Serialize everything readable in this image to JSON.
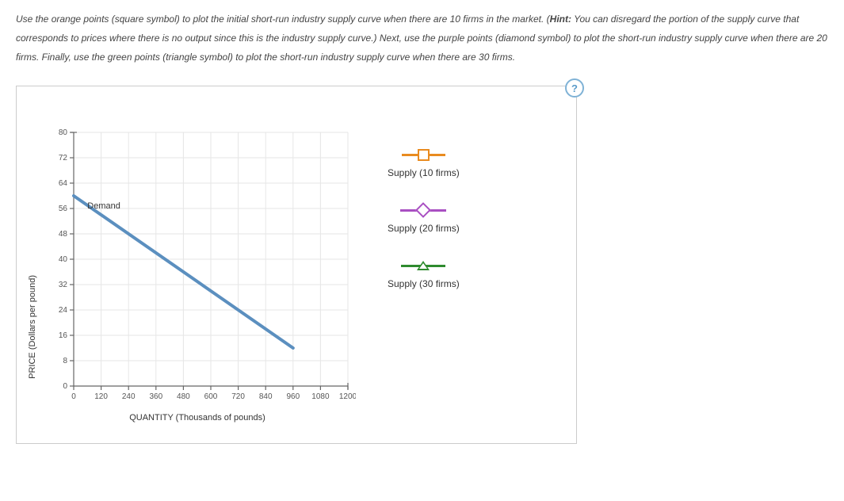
{
  "instructions": {
    "part1": "Use the orange points (square symbol) to plot the initial short-run industry supply curve when there are 10 firms in the market. (",
    "hint_label": "Hint:",
    "hint_body": " You can disregard the portion of the supply curve that corresponds to prices where there is no output since this is the industry supply curve.) Next, use the purple points (diamond symbol) to plot the short-run industry supply curve when there are 20 firms. Finally, use the green points (triangle symbol) to plot the short-run industry supply curve when there are 30 firms."
  },
  "help": "?",
  "chart_data": {
    "type": "line",
    "title": "",
    "xlabel": "QUANTITY (Thousands of pounds)",
    "ylabel": "PRICE (Dollars per pound)",
    "xlim": [
      0,
      1200
    ],
    "ylim": [
      0,
      80
    ],
    "x_ticks": [
      0,
      120,
      240,
      360,
      480,
      600,
      720,
      840,
      960,
      1080,
      1200
    ],
    "y_ticks": [
      0,
      8,
      16,
      24,
      32,
      40,
      48,
      56,
      64,
      72,
      80
    ],
    "grid": true,
    "series": [
      {
        "name": "Demand",
        "x": [
          0,
          960
        ],
        "y": [
          60,
          12
        ]
      }
    ],
    "annotations": [
      {
        "text": "Demand",
        "x": 60,
        "y": 56
      }
    ],
    "legend": [
      {
        "name": "Supply (10 firms)",
        "symbol": "square",
        "color": "#e98b1f"
      },
      {
        "name": "Supply (20 firms)",
        "symbol": "diamond",
        "color": "#a94fc2"
      },
      {
        "name": "Supply (30 firms)",
        "symbol": "triangle",
        "color": "#2e8b2e"
      }
    ]
  }
}
